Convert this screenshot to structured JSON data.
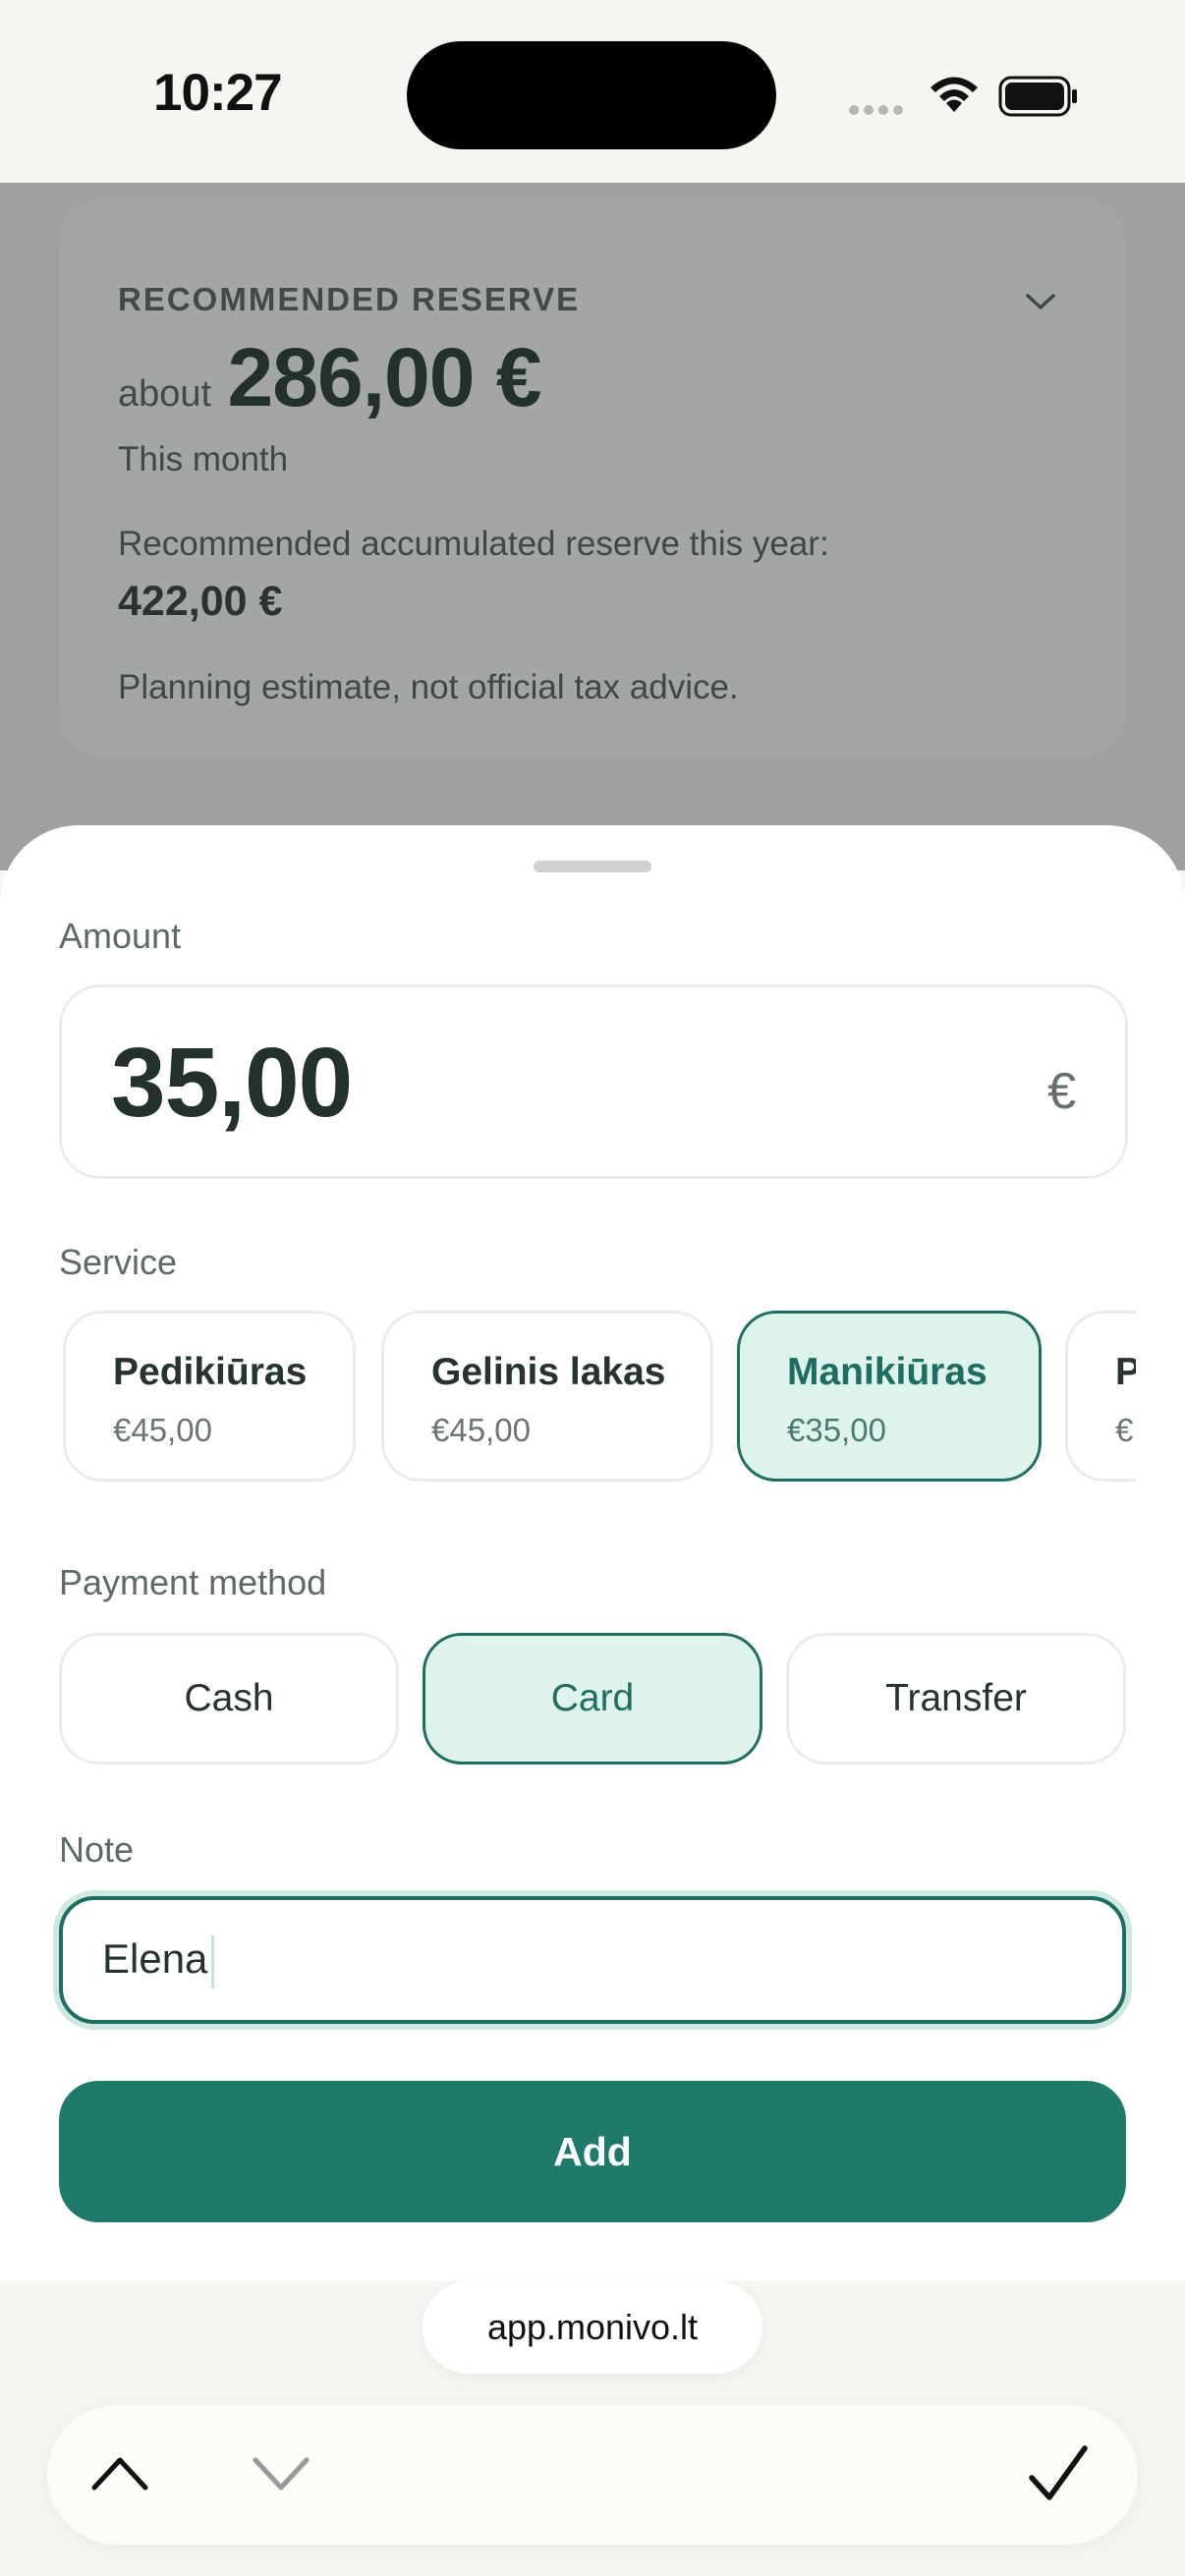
{
  "status_bar": {
    "time": "10:27"
  },
  "reserve": {
    "heading": "RECOMMENDED RESERVE",
    "about": "about",
    "amount": "286,00 €",
    "period": "This month",
    "accumulated_label": "Recommended accumulated reserve this year:",
    "accumulated_value": "422,00 €",
    "disclaimer": "Planning estimate, not official tax advice."
  },
  "form": {
    "amount_label": "Amount",
    "amount_value": "35,00",
    "currency": "€",
    "service_label": "Service",
    "services": [
      {
        "name": "Pedikiūras",
        "price": "€45,00",
        "selected": false
      },
      {
        "name": "Gelinis lakas",
        "price": "€45,00",
        "selected": false
      },
      {
        "name": "Manikiūras",
        "price": "€35,00",
        "selected": true
      },
      {
        "name": "P",
        "price": "€",
        "selected": false
      }
    ],
    "payment_label": "Payment method",
    "payment_methods": [
      {
        "label": "Cash",
        "selected": false
      },
      {
        "label": "Card",
        "selected": true
      },
      {
        "label": "Transfer",
        "selected": false
      }
    ],
    "note_label": "Note",
    "note_value": "Elena",
    "submit_label": "Add"
  },
  "browser": {
    "url": "app.monivo.lt"
  },
  "colors": {
    "accent": "#1f7a6b",
    "accent_dark": "#1f6d61",
    "selected_bg": "#dff3ed",
    "overlay": "#9ea1a0"
  }
}
